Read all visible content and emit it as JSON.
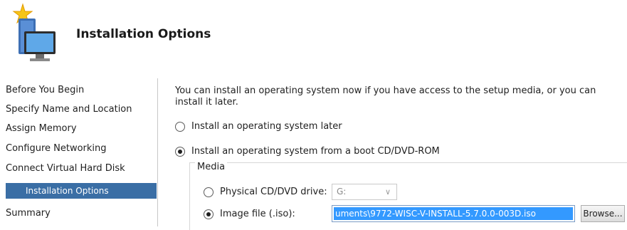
{
  "header": {
    "title": "Installation Options",
    "icon": "computer-wizard-icon"
  },
  "sidebar": {
    "items": [
      {
        "label": "Before You Begin"
      },
      {
        "label": "Specify Name and Location"
      },
      {
        "label": "Assign Memory"
      },
      {
        "label": "Configure Networking"
      },
      {
        "label": "Connect Virtual Hard Disk"
      },
      {
        "label": "Installation Options",
        "selected": true
      },
      {
        "label": "Summary"
      }
    ],
    "selected_color": "#3a6ea5"
  },
  "main": {
    "intro": "You can install an operating system now if you have access to the setup media, or you can install it later.",
    "option_later": {
      "label": "Install an operating system later",
      "checked": false
    },
    "option_boot": {
      "label": "Install an operating system from a boot CD/DVD-ROM",
      "checked": true
    },
    "media": {
      "label": "Media",
      "physical_drive": {
        "label": "Physical CD/DVD drive:",
        "value": "G:",
        "checked": false
      },
      "image_file": {
        "label": "Image file (.iso):",
        "value": "uments\\9772-WISC-V-INSTALL-5.7.0.0-003D.iso",
        "checked": true
      },
      "browse_label": "Browse..."
    }
  }
}
